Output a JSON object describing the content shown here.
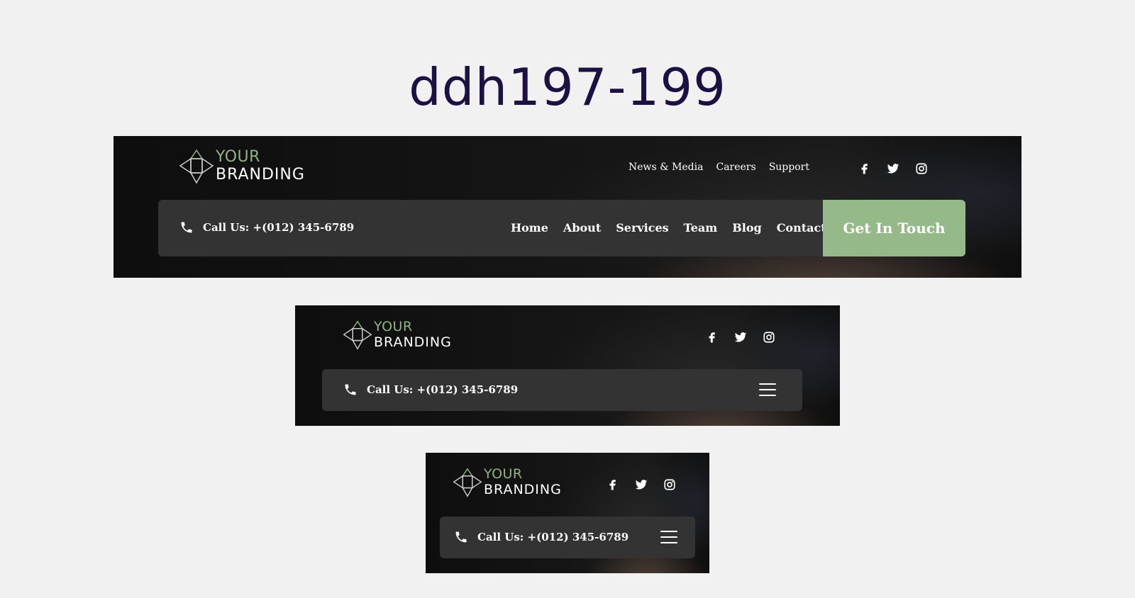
{
  "page": {
    "title": "ddh197-199"
  },
  "brand": {
    "line1": "YOUR",
    "line2": "BRANDING",
    "accent": "#8fb382"
  },
  "top_links": [
    "News & Media",
    "Careers",
    "Support"
  ],
  "social_icons": [
    "facebook-icon",
    "twitter-icon",
    "instagram-icon"
  ],
  "phone": {
    "icon": "phone-icon",
    "label": "Call Us: +(012) 345-6789"
  },
  "nav": [
    "Home",
    "About",
    "Services",
    "Team",
    "Blog",
    "Contact"
  ],
  "cta": {
    "label": "Get In Touch",
    "color": "#96b98a"
  },
  "menu_icon": "hamburger-menu-icon",
  "colors": {
    "bar": "#333333",
    "header_bg": "#111111",
    "title": "#1c1140"
  }
}
